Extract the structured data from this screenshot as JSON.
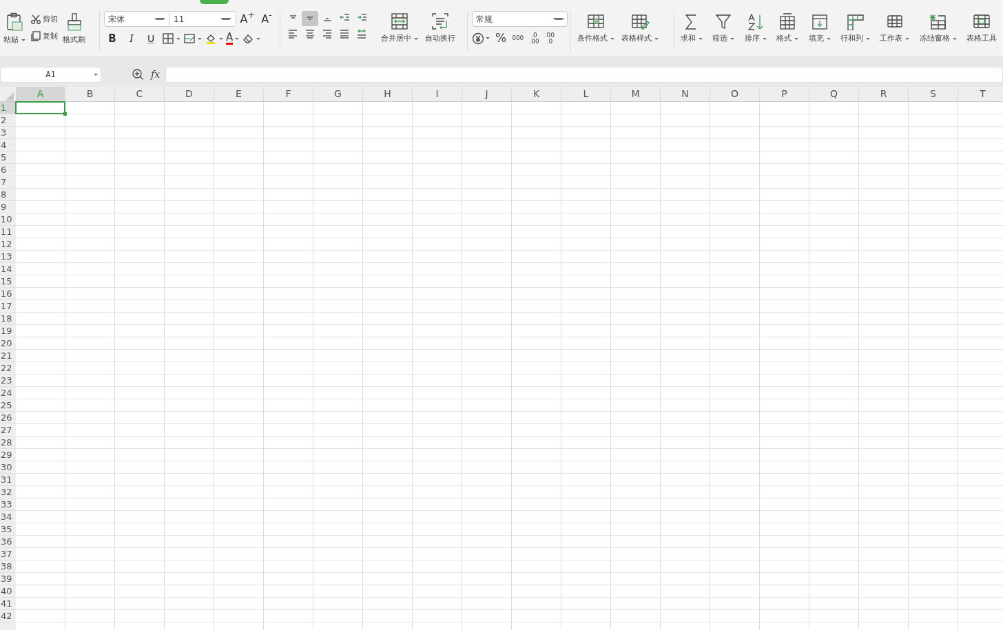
{
  "ribbon": {
    "clipboard": {
      "paste": "粘贴",
      "cut": "剪切",
      "copy": "复制",
      "format_painter": "格式刷"
    },
    "font": {
      "name": "宋体",
      "size": "11",
      "grow": "A$^{+}$",
      "shrink": "A$^{-}$",
      "bold": "B",
      "italic": "I",
      "underline": "U",
      "font_color": "A"
    },
    "alignment": {
      "buttons": [
        {
          "kind": "top",
          "selected": false
        },
        {
          "kind": "middle",
          "selected": true
        },
        {
          "kind": "bottom",
          "selected": false
        },
        {
          "kind": "outdent",
          "selected": false
        },
        {
          "kind": "indent",
          "selected": false
        },
        {
          "kind": "left",
          "selected": false
        },
        {
          "kind": "center",
          "selected": false
        },
        {
          "kind": "right",
          "selected": false
        },
        {
          "kind": "justify",
          "selected": false
        },
        {
          "kind": "distribute",
          "selected": false
        }
      ],
      "merge": "合并居中",
      "wrap": "自动换行"
    },
    "number": {
      "format": "常规",
      "percent": "%",
      "thousands": "000",
      "increase_decimal": [
        ".0",
        ".00"
      ],
      "decrease_decimal": [
        ".00",
        ".0"
      ]
    },
    "styles": [
      {
        "kind": "conditional",
        "label": "条件格式",
        "dropdown": true
      },
      {
        "kind": "table-style",
        "label": "表格样式",
        "dropdown": true
      }
    ],
    "tools": [
      {
        "kind": "sum",
        "label": "求和",
        "dropdown": true
      },
      {
        "kind": "filter",
        "label": "筛选",
        "dropdown": true
      },
      {
        "kind": "sort",
        "label": "排序",
        "dropdown": true
      },
      {
        "kind": "format",
        "label": "格式",
        "dropdown": true
      },
      {
        "kind": "fill",
        "label": "填充",
        "dropdown": true
      },
      {
        "kind": "rowcol",
        "label": "行和列",
        "dropdown": true
      },
      {
        "kind": "sheet",
        "label": "工作表",
        "dropdown": true
      },
      {
        "kind": "freeze",
        "label": "冻结窗格",
        "dropdown": true
      },
      {
        "kind": "table-tools",
        "label": "表格工具",
        "dropdown": false
      }
    ]
  },
  "name_box": "A1",
  "formula_label": "fx",
  "columns": [
    {
      "label": "A",
      "selected": true
    },
    {
      "label": "B",
      "selected": false
    },
    {
      "label": "C",
      "selected": false
    },
    {
      "label": "D",
      "selected": false
    },
    {
      "label": "E",
      "selected": false
    },
    {
      "label": "F",
      "selected": false
    },
    {
      "label": "G",
      "selected": false
    },
    {
      "label": "H",
      "selected": false
    },
    {
      "label": "I",
      "selected": false
    },
    {
      "label": "J",
      "selected": false
    },
    {
      "label": "K",
      "selected": false
    },
    {
      "label": "L",
      "selected": false
    },
    {
      "label": "M",
      "selected": false
    },
    {
      "label": "N",
      "selected": false
    },
    {
      "label": "O",
      "selected": false
    },
    {
      "label": "P",
      "selected": false
    },
    {
      "label": "Q",
      "selected": false
    },
    {
      "label": "R",
      "selected": false
    },
    {
      "label": "S",
      "selected": false
    },
    {
      "label": "T",
      "selected": false
    }
  ],
  "rows": [
    {
      "label": "1",
      "selected": true
    },
    {
      "label": "2",
      "selected": false
    },
    {
      "label": "3",
      "selected": false
    },
    {
      "label": "4",
      "selected": false
    },
    {
      "label": "5",
      "selected": false
    },
    {
      "label": "6",
      "selected": false
    },
    {
      "label": "7",
      "selected": false
    },
    {
      "label": "8",
      "selected": false
    },
    {
      "label": "9",
      "selected": false
    },
    {
      "label": "10",
      "selected": false
    },
    {
      "label": "11",
      "selected": false
    },
    {
      "label": "12",
      "selected": false
    },
    {
      "label": "13",
      "selected": false
    },
    {
      "label": "14",
      "selected": false
    },
    {
      "label": "15",
      "selected": false
    },
    {
      "label": "16",
      "selected": false
    },
    {
      "label": "17",
      "selected": false
    },
    {
      "label": "18",
      "selected": false
    },
    {
      "label": "19",
      "selected": false
    },
    {
      "label": "20",
      "selected": false
    },
    {
      "label": "21",
      "selected": false
    },
    {
      "label": "22",
      "selected": false
    },
    {
      "label": "23",
      "selected": false
    },
    {
      "label": "24",
      "selected": false
    },
    {
      "label": "25",
      "selected": false
    },
    {
      "label": "26",
      "selected": false
    },
    {
      "label": "27",
      "selected": false
    },
    {
      "label": "28",
      "selected": false
    },
    {
      "label": "29",
      "selected": false
    },
    {
      "label": "30",
      "selected": false
    },
    {
      "label": "31",
      "selected": false
    },
    {
      "label": "32",
      "selected": false
    },
    {
      "label": "33",
      "selected": false
    },
    {
      "label": "34",
      "selected": false
    },
    {
      "label": "35",
      "selected": false
    },
    {
      "label": "36",
      "selected": false
    },
    {
      "label": "37",
      "selected": false
    },
    {
      "label": "38",
      "selected": false
    },
    {
      "label": "39",
      "selected": false
    },
    {
      "label": "40",
      "selected": false
    },
    {
      "label": "41",
      "selected": false
    },
    {
      "label": "42",
      "selected": false
    }
  ]
}
